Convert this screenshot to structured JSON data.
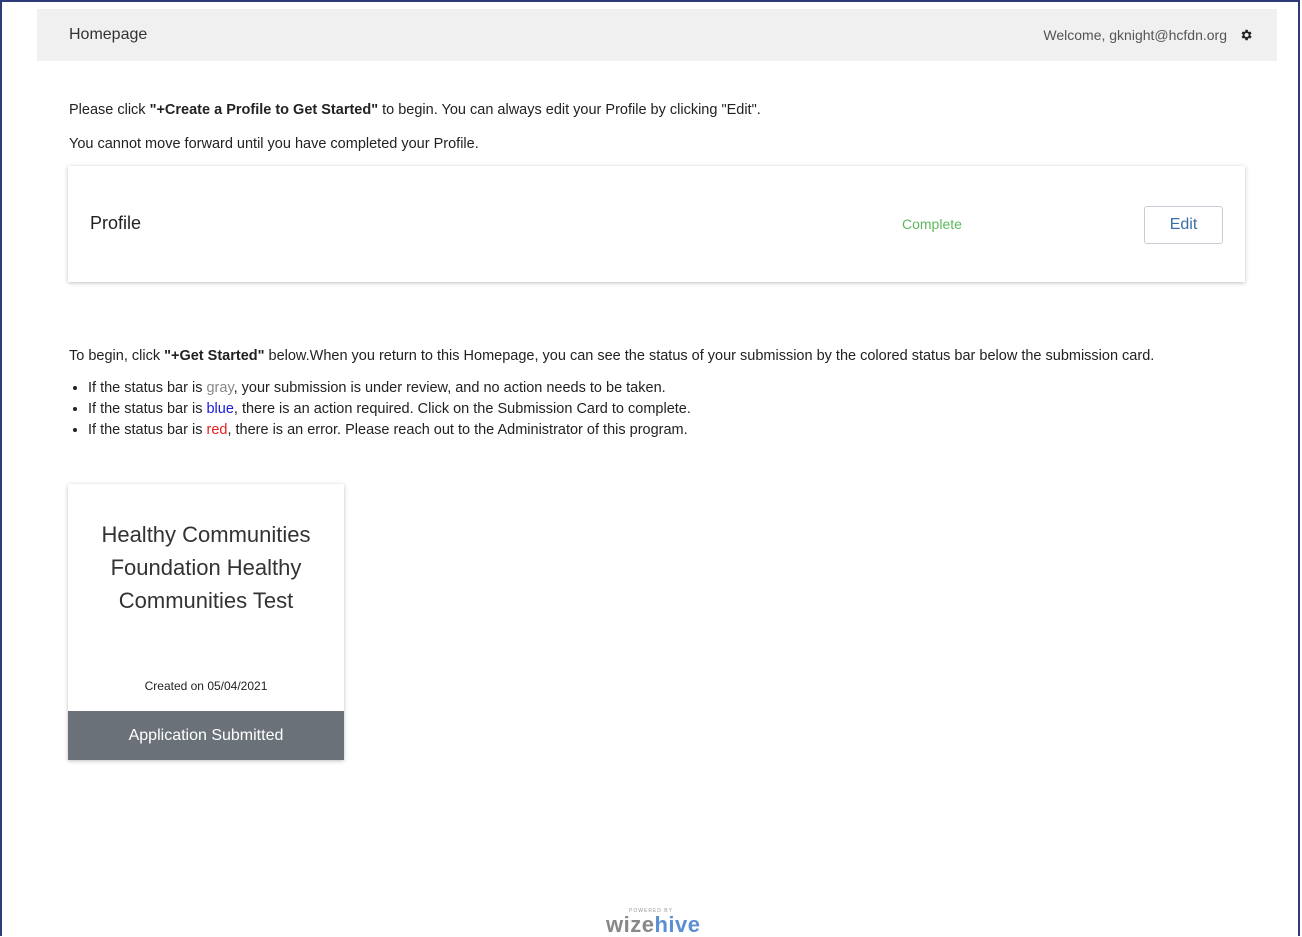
{
  "header": {
    "title": "Homepage",
    "welcome": "Welcome, gknight@hcfdn.org",
    "settings_icon": "gear-icon"
  },
  "intro": {
    "line1_prefix": "Please click ",
    "line1_bold": "\"+Create a Profile to Get Started\"",
    "line1_suffix": " to begin. You can always edit your Profile by clicking \"Edit\".",
    "line2": "You cannot move forward until you have completed your Profile."
  },
  "profile_card": {
    "label": "Profile",
    "status": "Complete",
    "edit_label": "Edit",
    "status_color": "#5cb85c"
  },
  "instructions": {
    "prefix": "To begin, click ",
    "bold": "\"+Get Started\"",
    "suffix": " below.When you return to this Homepage, you can see the status of your submission by the colored status bar below the submission card.",
    "bullets": [
      {
        "before": "If the status bar is ",
        "color_word": "gray",
        "after": ", your submission is under review, and no action needs to be taken."
      },
      {
        "before": "If the status bar is ",
        "color_word": "blue",
        "after": ", there is an action required. Click on the Submission Card to complete."
      },
      {
        "before": "If the status bar is ",
        "color_word": "red",
        "after": ", there is an error. Please reach out to the Administrator of this program."
      }
    ]
  },
  "submission_card": {
    "name": "Healthy Communities Foundation Healthy Communities Test",
    "created": "Created on 05/04/2021",
    "status": "Application Submitted",
    "status_bar_color": "#6b7179"
  },
  "footer": {
    "powered_by": "POWERED BY",
    "brand_part1": "wize",
    "brand_part2": "hive"
  }
}
